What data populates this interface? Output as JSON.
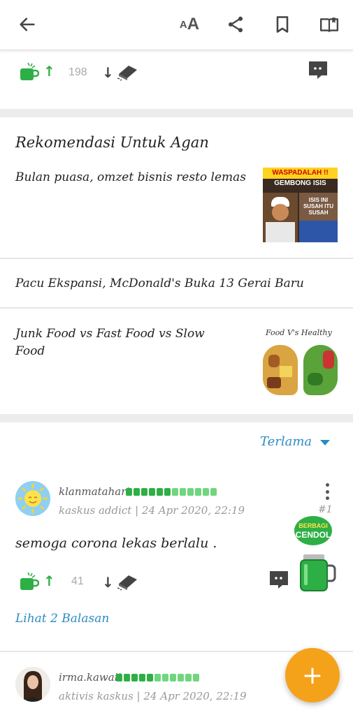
{
  "toolbar": {
    "back_icon": "arrow-left-icon",
    "text_size_small": "A",
    "text_size_large": "A",
    "share_icon": "share-icon",
    "bookmark_icon": "bookmark-icon",
    "reader_icon": "open-book-icon"
  },
  "thread_votes": {
    "count": "198"
  },
  "recommendations": {
    "title": "Rekomendasi Untuk Agan",
    "items": [
      {
        "text": "Bulan puasa, omzet bisnis resto lemas",
        "thumb_caption_1": "WASPADALAH !!",
        "thumb_caption_2": "GEMBONG ISIS",
        "thumb_caption_3": "ISIS INI SUSAH ITU SUSAH"
      },
      {
        "text": "Pacu Ekspansi, McDonald's Buka 13 Gerai Baru"
      },
      {
        "text": "Junk Food vs Fast Food vs Slow Food",
        "thumb_caption_1": "Food V's Healthy"
      }
    ]
  },
  "sort": {
    "label": "Terlama"
  },
  "comments": [
    {
      "username": "klanmatahari",
      "rank": "kaskus addict",
      "date": "24 Apr 2020, 22:19",
      "post_no": "#1",
      "text": "semoga corona lekas berlalu .",
      "votes": "41",
      "badge_top": "BERBAGI",
      "badge_bottom": "CENDOL",
      "replies_label": "Lihat 2 Balasan"
    },
    {
      "username": "irma.kawaii",
      "rank": "aktivis kaskus",
      "date": "24 Apr 2020, 22:19"
    }
  ],
  "fab": {
    "label": "+"
  },
  "colors": {
    "accent_blue": "#2b8cc4",
    "cendol_green": "#2eaf45",
    "fab_orange": "#f5a21b"
  }
}
